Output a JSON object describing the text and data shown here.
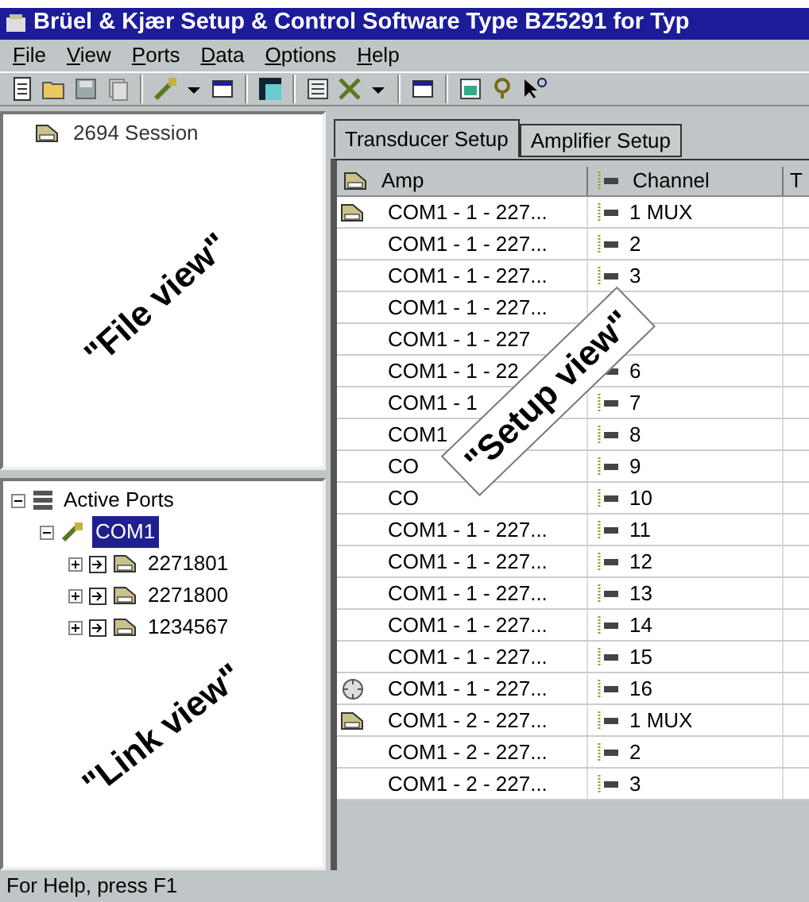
{
  "window": {
    "title": "Brüel & Kjær Setup & Control Software Type BZ5291 for Typ"
  },
  "menu": [
    {
      "label": "File"
    },
    {
      "label": "View"
    },
    {
      "label": "Ports"
    },
    {
      "label": "Data"
    },
    {
      "label": "Options"
    },
    {
      "label": "Help"
    }
  ],
  "file_view": {
    "items": [
      {
        "label": "2694  Session"
      }
    ],
    "annotation": "\"File view\""
  },
  "link_view": {
    "tree": [
      {
        "label": "Active Ports",
        "kind": "ports",
        "expanded": true,
        "selected": false,
        "children": [
          {
            "label": "COM1",
            "kind": "com",
            "expanded": true,
            "selected": true,
            "children": [
              {
                "label": "2271801",
                "kind": "amp",
                "expanded": false,
                "selected": false
              },
              {
                "label": "2271800",
                "kind": "amp",
                "expanded": false,
                "selected": false
              },
              {
                "label": "1234567",
                "kind": "amp",
                "expanded": false,
                "selected": false
              }
            ]
          }
        ]
      }
    ],
    "annotation": "\"Link view\""
  },
  "tabs": [
    {
      "label": "Transducer Setup",
      "selected": true
    },
    {
      "label": "Amplifier Setup",
      "selected": false
    }
  ],
  "table": {
    "columns": [
      "Amp",
      "Channel",
      "T"
    ],
    "annotation": "\"Setup view\"",
    "rows": [
      {
        "kind": "amp",
        "amp": "COM1 - 1 - 227...",
        "channel": "1  MUX"
      },
      {
        "amp": "COM1 - 1 - 227...",
        "channel": "2"
      },
      {
        "amp": "COM1 - 1 - 227...",
        "channel": "3"
      },
      {
        "amp": "COM1 - 1 - 227..."
      },
      {
        "amp": "COM1 - 1 - 227"
      },
      {
        "amp": "COM1 - 1 - 22",
        "channel": "6"
      },
      {
        "amp": "COM1 - 1",
        "channel": "7"
      },
      {
        "amp": "COM1",
        "channel": "8"
      },
      {
        "amp": "CO",
        "channel": "9"
      },
      {
        "amp": "CO",
        "channel": "10"
      },
      {
        "amp": "COM1 - 1 - 227...",
        "channel": "11"
      },
      {
        "amp": "COM1 - 1 - 227...",
        "channel": "12"
      },
      {
        "amp": "COM1 - 1 - 227...",
        "channel": "13"
      },
      {
        "amp": "COM1 - 1 - 227...",
        "channel": "14"
      },
      {
        "amp": "COM1 - 1 - 227...",
        "channel": "15"
      },
      {
        "kind": "target",
        "amp": "COM1 - 1 - 227...",
        "channel": "16"
      },
      {
        "kind": "amp",
        "amp": "COM1 - 2 - 227...",
        "channel": "1  MUX"
      },
      {
        "amp": "COM1 - 2 - 227...",
        "channel": "2"
      },
      {
        "amp": "COM1 - 2 - 227...",
        "channel": "3"
      }
    ]
  },
  "status_bar": {
    "text": "For Help, press F1"
  }
}
